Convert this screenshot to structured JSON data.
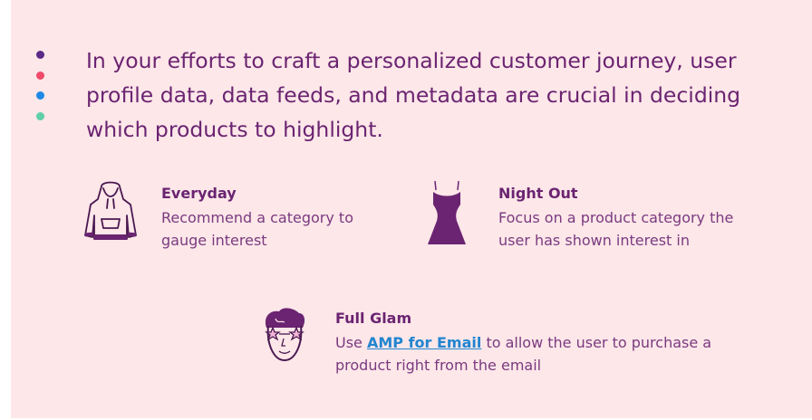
{
  "colors": {
    "panel_bg": "#fde7e9",
    "text": "#6b2471",
    "link": "#2185d0",
    "bullet_colors": [
      "#5b2a86",
      "#ef4a6a",
      "#1e88e5",
      "#5ecfa8"
    ]
  },
  "intro": "In your efforts to craft a personalized customer journey, user profile data, data feeds, and metadata are crucial in deciding which products to highlight.",
  "items": [
    {
      "icon": "hoodie-icon",
      "title": "Everyday",
      "description": "Recommend a category to gauge interest"
    },
    {
      "icon": "dress-icon",
      "title": "Night Out",
      "description": "Focus on a product category the user has shown interest in"
    },
    {
      "icon": "glam-face-icon",
      "title": "Full Glam",
      "description_before": "Use ",
      "link_text": "AMP for Email",
      "description_after": " to allow the user to purchase a product right from the email"
    }
  ]
}
